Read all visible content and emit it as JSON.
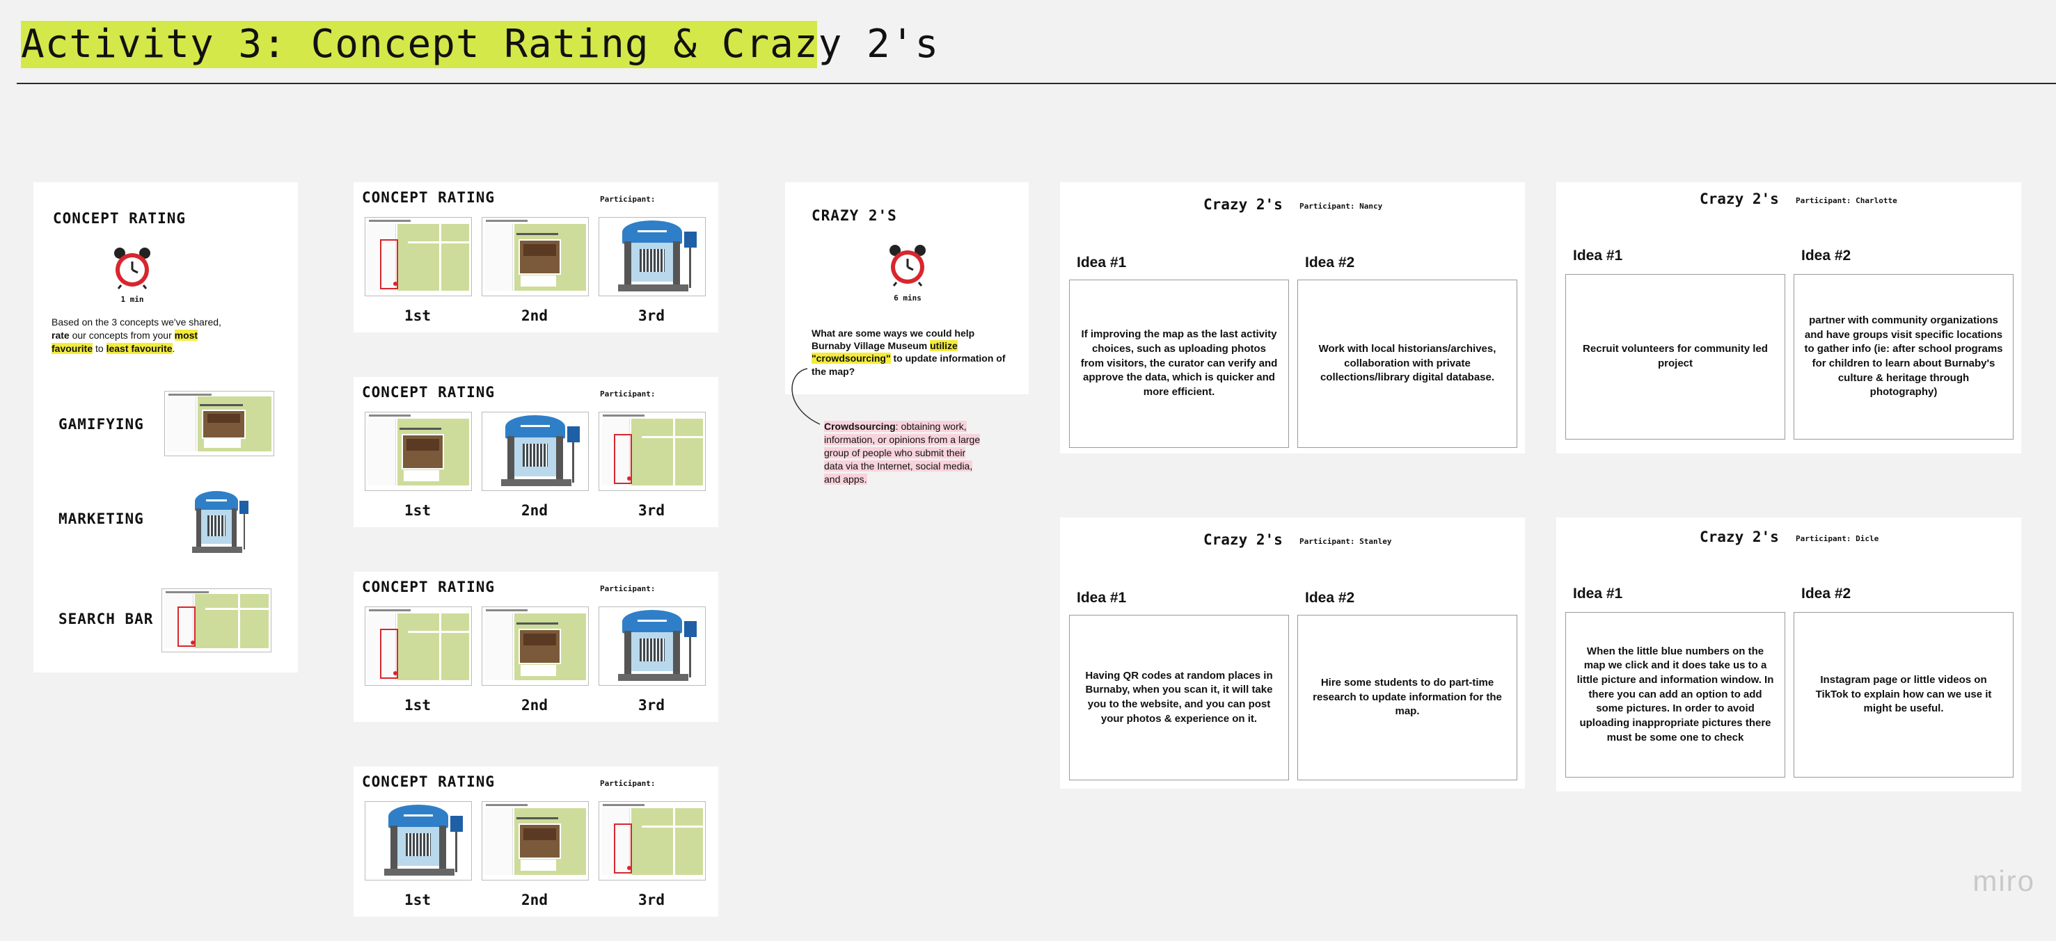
{
  "title": "Activity 3: Concept Rating & Crazy 2's",
  "concept_rating_intro": {
    "heading": "CONCEPT RATING",
    "timer": "1 min",
    "desc_part1": "Based on the 3 concepts we've shared, ",
    "desc_rate": "rate",
    "desc_part2": " our concepts from your ",
    "desc_most": "most favourite",
    "desc_to": " to ",
    "desc_least": "least favourite",
    "desc_end": ".",
    "concepts": [
      "GAMIFYING",
      "MARKETING",
      "SEARCH BAR"
    ]
  },
  "rating_cards": [
    {
      "title": "CONCEPT RATING",
      "participant": "Participant:",
      "order": [
        "map",
        "photo",
        "shelter"
      ],
      "ranks": [
        "1st",
        "2nd",
        "3rd"
      ]
    },
    {
      "title": "CONCEPT RATING",
      "participant": "Participant:",
      "order": [
        "photo",
        "shelter",
        "map"
      ],
      "ranks": [
        "1st",
        "2nd",
        "3rd"
      ]
    },
    {
      "title": "CONCEPT RATING",
      "participant": "Participant:",
      "order": [
        "map",
        "photo",
        "shelter"
      ],
      "ranks": [
        "1st",
        "2nd",
        "3rd"
      ]
    },
    {
      "title": "CONCEPT RATING",
      "participant": "Participant:",
      "order": [
        "shelter",
        "photo",
        "map"
      ],
      "ranks": [
        "1st",
        "2nd",
        "3rd"
      ]
    }
  ],
  "crazy_intro": {
    "heading": "CRAZY 2'S",
    "timer": "6 mins",
    "q_part1": "What are some ways we could help Burnaby Village Museum ",
    "q_hl": "utilize \"crowdsourcing\"",
    "q_part2": " to update information of the map?",
    "def_term": "Crowdsourcing",
    "def_text": ": obtaining work, information, or opinions from a large group of people who submit their data via the Internet, social media, and  apps."
  },
  "crazy_cards": [
    {
      "title": "Crazy 2's",
      "participant": "Participant: Nancy",
      "idea1_label": "Idea #1",
      "idea1": "If improving the map as the last activity choices, such as uploading photos from visitors, the curator can verify and approve the data, which is quicker and more efficient.",
      "idea2_label": "Idea #2",
      "idea2": "Work with local historians/archives, collaboration with private collections/library digital database."
    },
    {
      "title": "Crazy 2's",
      "participant": "Participant: Charlotte",
      "idea1_label": "Idea #1",
      "idea1": "Recruit volunteers for community led project",
      "idea2_label": "Idea #2",
      "idea2": "partner with community organizations and have groups visit specific locations to gather info (ie: after school programs for children to learn about Burnaby's culture & heritage through photography)"
    },
    {
      "title": "Crazy 2's",
      "participant": "Participant: Stanley",
      "idea1_label": "Idea #1",
      "idea1": "Having QR codes at random places in Burnaby, when you scan it, it will take you to the website, and you can post your photos & experience on it.",
      "idea2_label": "Idea #2",
      "idea2": "Hire some students to do part-time research to update information for the map."
    },
    {
      "title": "Crazy 2's",
      "participant": "Participant: Dicle",
      "idea1_label": "Idea #1",
      "idea1": "When the little blue numbers on the map we click and it does take us to a little picture and information window. In there you can add an option to add some pictures. In order to avoid uploading inappropriate pictures there must be some one to check",
      "idea2_label": "Idea #2",
      "idea2": "Instagram page or little videos on TikTok to explain how can we use it might be useful."
    }
  ],
  "watermark": "miro",
  "colors": {
    "highlight_yellow": "#d4e84a",
    "text_highlight": "#f4ec3c",
    "pink_highlight": "#f8d3dc",
    "clock_red": "#d8262e",
    "shelter_blue": "#2f7fc8"
  },
  "icons": {
    "timer": "alarm-clock-icon"
  }
}
